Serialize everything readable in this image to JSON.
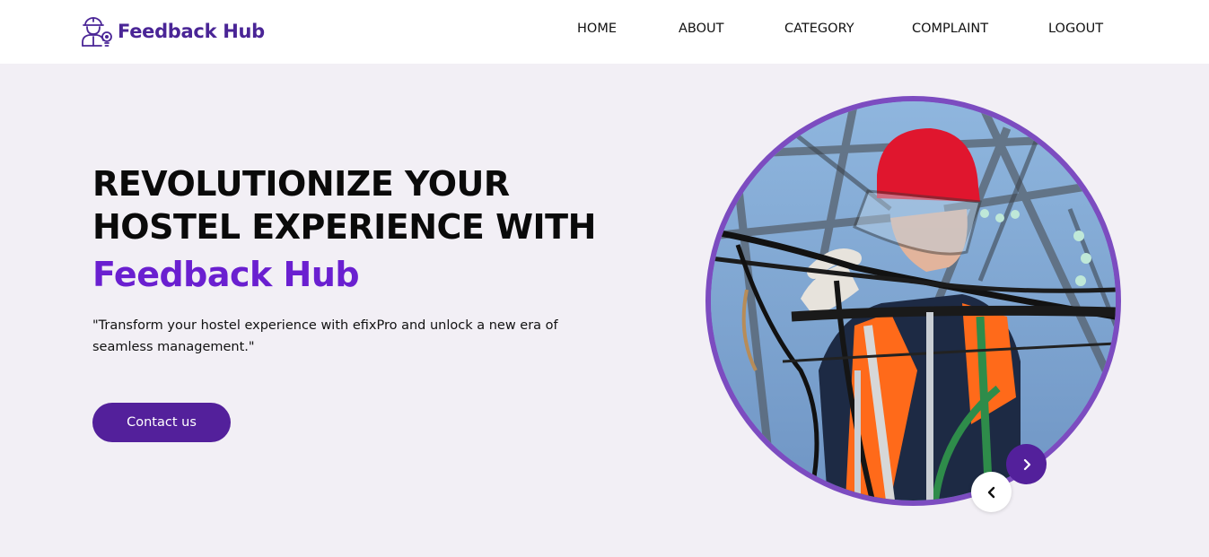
{
  "brand": {
    "name": "Feedback Hub",
    "logo_icon": "worker-idea-icon"
  },
  "nav": {
    "items": [
      {
        "label": "HOME"
      },
      {
        "label": "ABOUT"
      },
      {
        "label": "CATEGORY"
      },
      {
        "label": "COMPLAINT"
      },
      {
        "label": "LOGOUT"
      }
    ]
  },
  "hero": {
    "headline_line1": "REVOLUTIONIZE YOUR",
    "headline_line2": "HOSTEL EXPERIENCE WITH",
    "brand_accent": "Feedback Hub",
    "tagline": "\"Transform your hostel experience with efixPro and unlock a new era of seamless management.\"",
    "cta_label": "Contact us",
    "image_alt": "electrician-worker-photo",
    "carousel": {
      "prev_icon": "chevron-left-icon",
      "next_icon": "chevron-right-icon"
    }
  },
  "colors": {
    "brand_purple": "#4a2596",
    "accent_purple": "#6a1fd0",
    "button_purple": "#53209b",
    "ring_purple": "#7c4cc0",
    "hero_background": "#f2eff5",
    "navbar_background": "#ffffff"
  }
}
